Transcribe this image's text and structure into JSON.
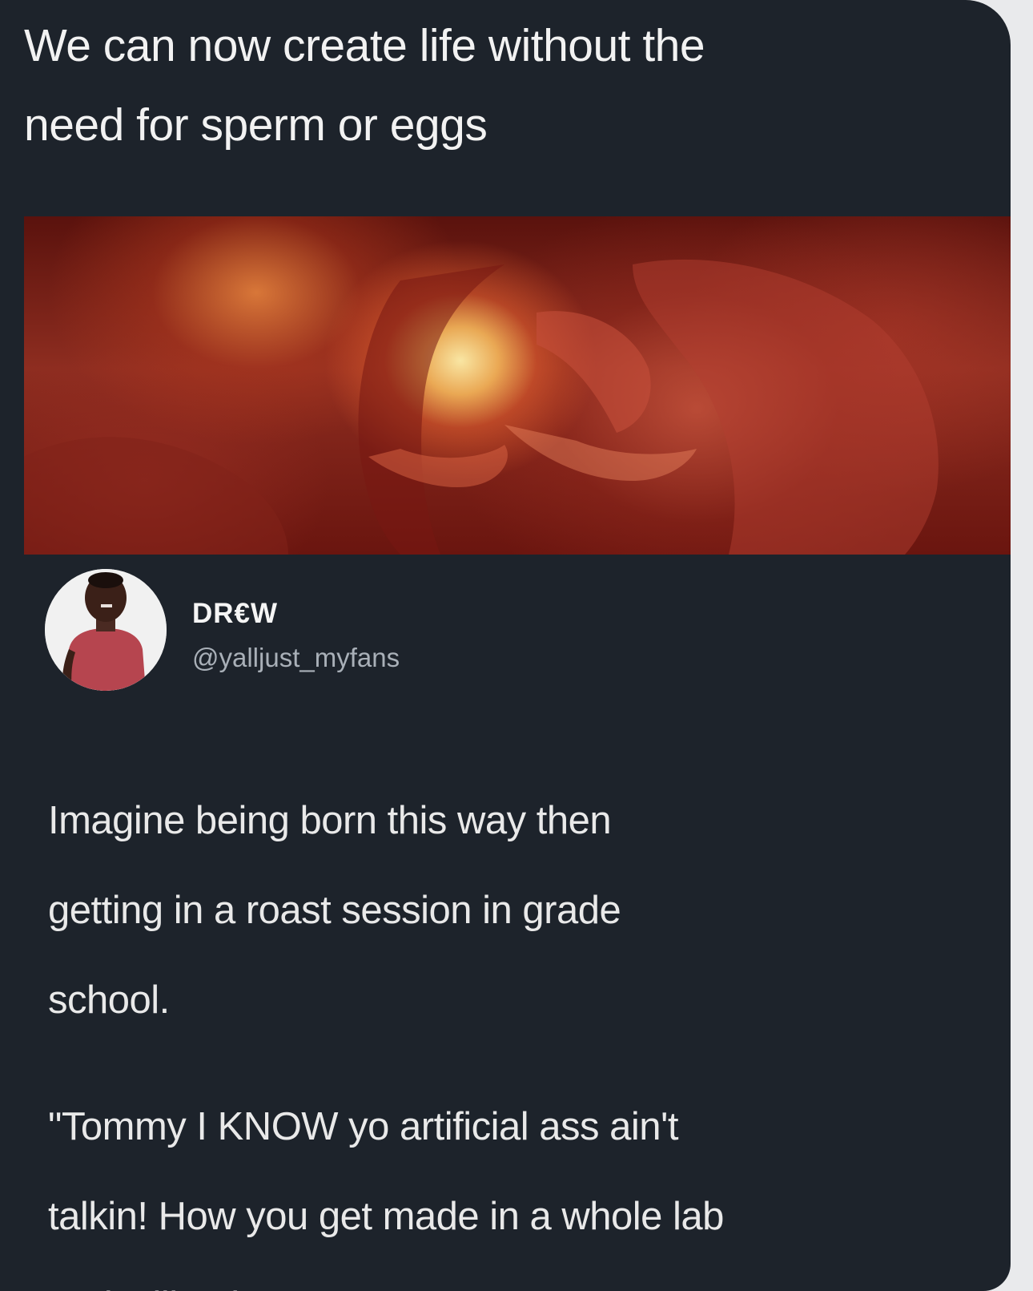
{
  "caption": {
    "lines": [
      "We can now create life without the",
      "need for sperm or eggs"
    ]
  },
  "media": {
    "description_icon": "embryo-photo"
  },
  "author": {
    "display_name": "DR€W",
    "handle": "@yalljust_myfans"
  },
  "tweet": {
    "body_lines": [
      "Imagine being born this way then",
      "getting in a roast session in grade",
      "school."
    ],
    "quote_lines": [
      "\"Tommy I KNOW yo artificial ass ain't",
      "talkin! How you get made in a whole lab",
      "and still ugly?\""
    ]
  },
  "colors": {
    "card_background": "#1d232b",
    "page_background": "#e9eaec",
    "primary_text": "#f2f2f2",
    "handle_text": "#a9b0b8",
    "avatar_shirt": "#b6454f"
  }
}
